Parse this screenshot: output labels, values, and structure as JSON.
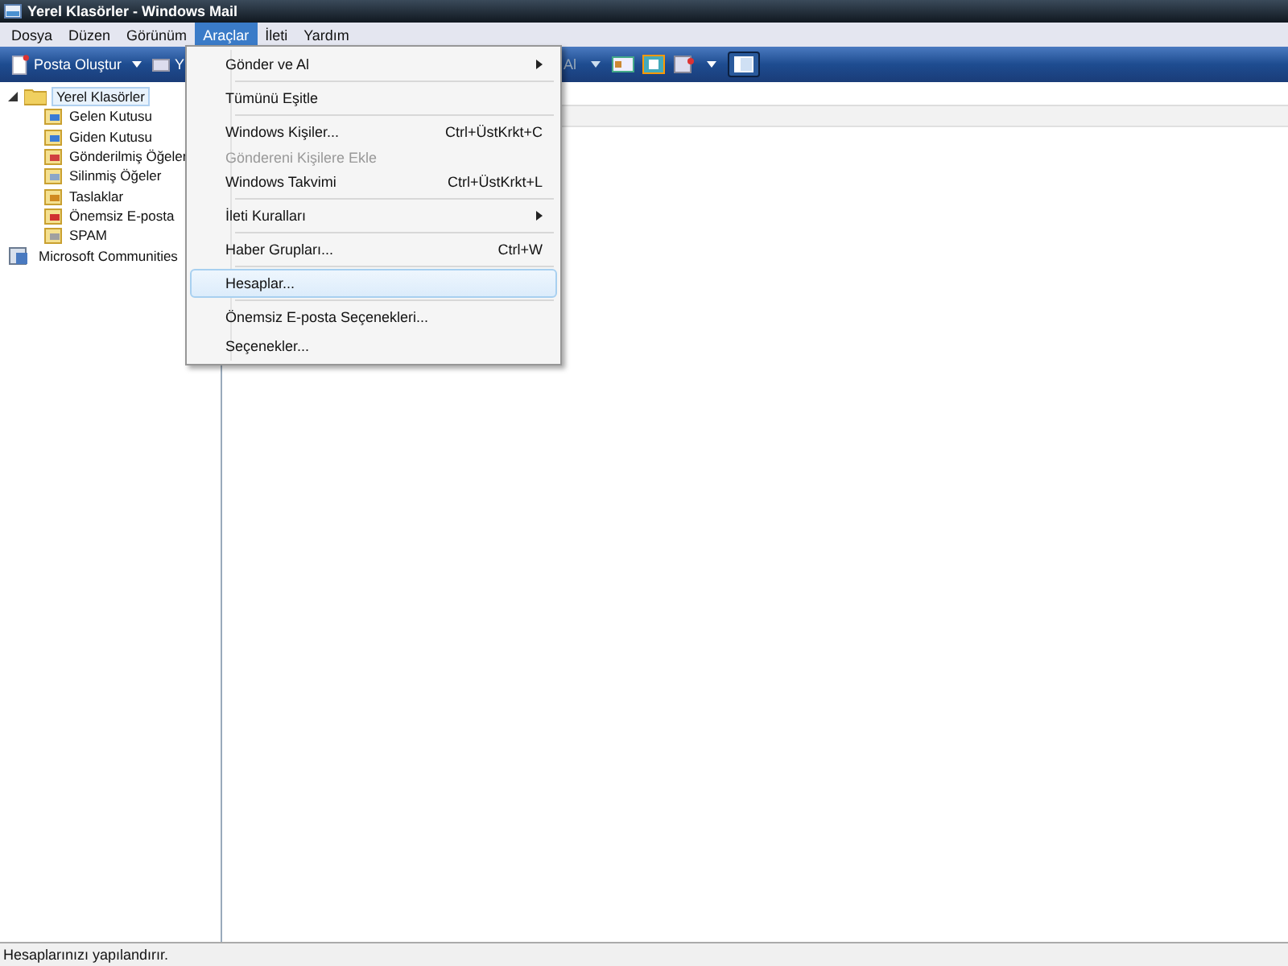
{
  "window": {
    "title": "Yerel Klasörler - Windows Mail"
  },
  "menu_bar": [
    {
      "label": "Dosya",
      "selected": false
    },
    {
      "label": "Düzen",
      "selected": false
    },
    {
      "label": "Görünüm",
      "selected": false
    },
    {
      "label": "Araçlar",
      "selected": true
    },
    {
      "label": "İleti",
      "selected": false
    },
    {
      "label": "Yardım",
      "selected": false
    }
  ],
  "toolbar": {
    "compose": "Posta Oluştur",
    "second_button": "Y",
    "send_receive": "Al"
  },
  "folders": {
    "label": "Yerel Klasörler",
    "selected": true,
    "expanded": true,
    "children": [
      {
        "label": "Gelen Kutusu"
      },
      {
        "label": "Giden Kutusu"
      },
      {
        "label": "Gönderilmiş Öğeler"
      },
      {
        "label": "Silinmiş Öğeler"
      },
      {
        "label": "Taslaklar"
      },
      {
        "label": "Önemsiz E-posta"
      },
      {
        "label": "SPAM"
      }
    ]
  },
  "communities": {
    "label": "Microsoft Communities"
  },
  "tools_menu": [
    {
      "kind": "item",
      "label": "Gönder ve Al",
      "submenu": true,
      "disabled": false,
      "selected": false
    },
    {
      "kind": "separator"
    },
    {
      "kind": "item",
      "label": "Tümünü Eşitle",
      "disabled": false,
      "selected": false
    },
    {
      "kind": "separator"
    },
    {
      "kind": "item",
      "label": "Windows Kişiler...",
      "shortcut": "Ctrl+ÜstKrkt+C",
      "disabled": false,
      "selected": false
    },
    {
      "kind": "item",
      "label": "Göndereni Kişilere Ekle",
      "disabled": true,
      "selected": false
    },
    {
      "kind": "item",
      "label": "Windows Takvimi",
      "shortcut": "Ctrl+ÜstKrkt+L",
      "disabled": false,
      "selected": false
    },
    {
      "kind": "separator"
    },
    {
      "kind": "item",
      "label": "İleti Kuralları",
      "submenu": true,
      "disabled": false,
      "selected": false
    },
    {
      "kind": "separator"
    },
    {
      "kind": "item",
      "label": "Haber Grupları...",
      "shortcut": "Ctrl+W",
      "disabled": false,
      "selected": false
    },
    {
      "kind": "separator"
    },
    {
      "kind": "item",
      "label": "Hesaplar...",
      "disabled": false,
      "selected": true
    },
    {
      "kind": "separator"
    },
    {
      "kind": "item",
      "label": "Önemsiz E-posta Seçenekleri...",
      "disabled": false,
      "selected": false
    },
    {
      "kind": "item",
      "label": "Seçenekler...",
      "disabled": false,
      "selected": false
    }
  ],
  "status_bar": "Hesaplarınızı yapılandırır."
}
